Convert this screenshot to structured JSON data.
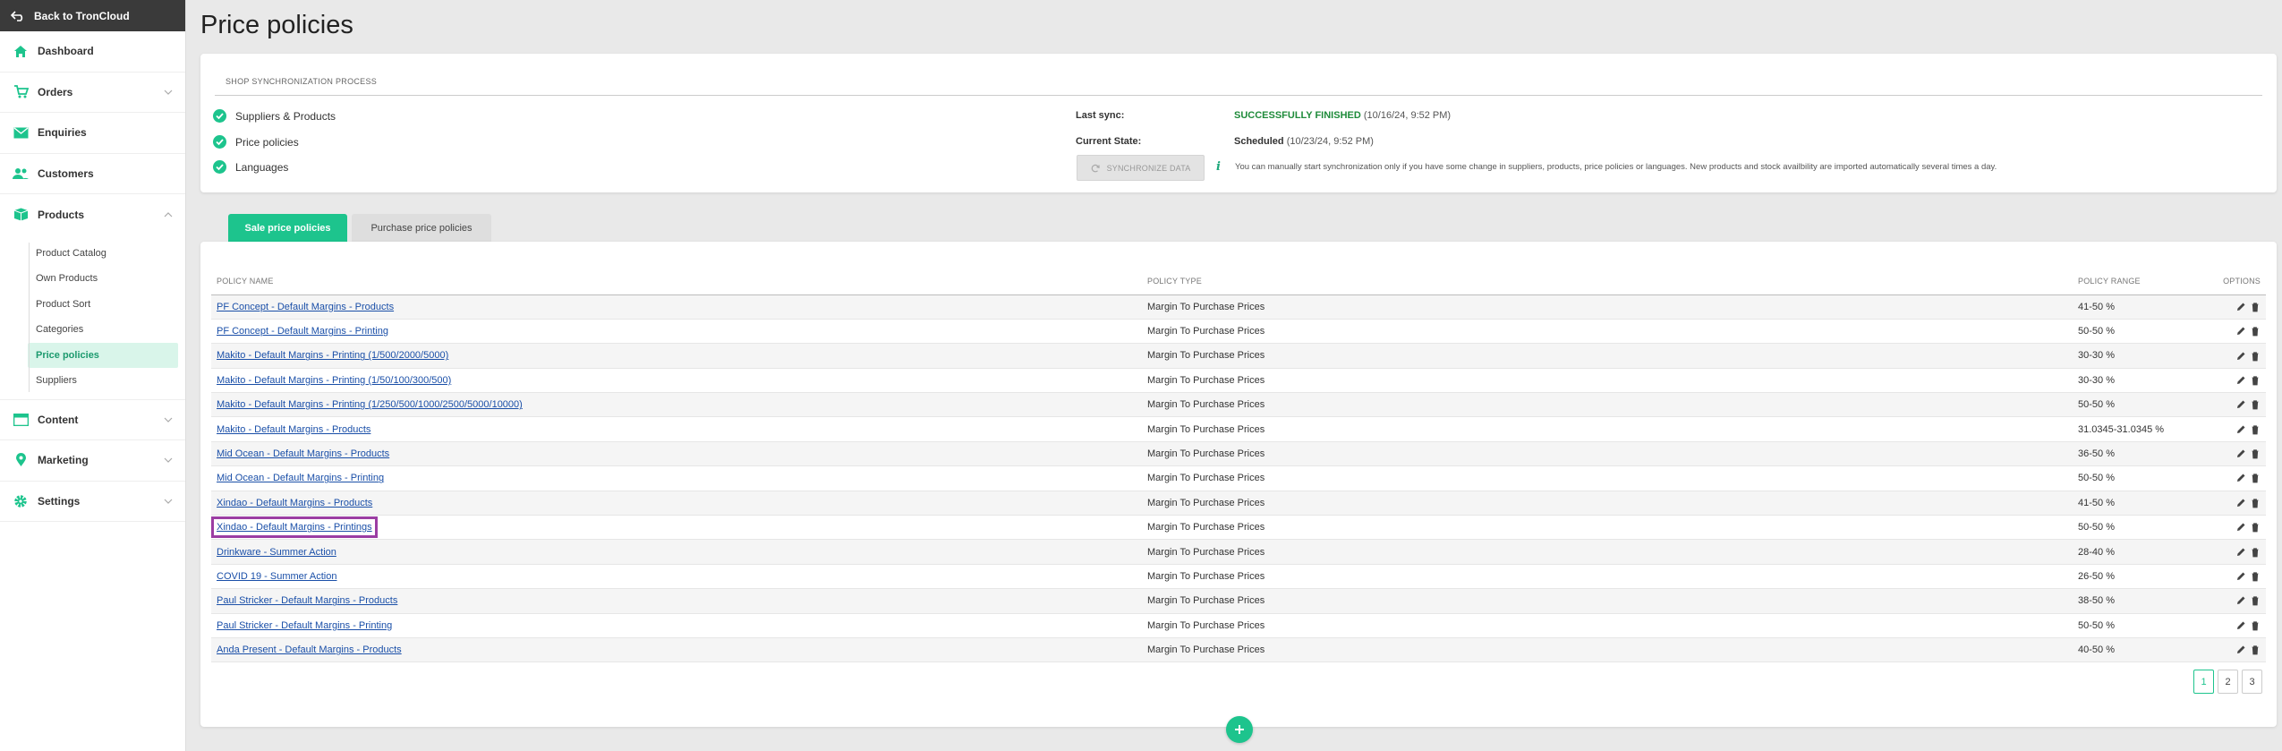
{
  "sidebar": {
    "back_label": "Back to TronCloud",
    "items": [
      {
        "label": "Dashboard"
      },
      {
        "label": "Orders"
      },
      {
        "label": "Enquiries"
      },
      {
        "label": "Customers"
      },
      {
        "label": "Products"
      },
      {
        "label": "Content"
      },
      {
        "label": "Marketing"
      },
      {
        "label": "Settings"
      }
    ],
    "product_subitems": [
      {
        "label": "Product Catalog"
      },
      {
        "label": "Own Products"
      },
      {
        "label": "Product Sort"
      },
      {
        "label": "Categories"
      },
      {
        "label": "Price policies"
      },
      {
        "label": "Suppliers"
      }
    ],
    "active_subitem": "Price policies"
  },
  "page": {
    "title": "Price policies"
  },
  "sync": {
    "heading": "SHOP SYNCHRONIZATION PROCESS",
    "checks": [
      "Suppliers & Products",
      "Price policies",
      "Languages"
    ],
    "last_sync_label": "Last sync:",
    "last_sync_status": "SUCCESSFULLY FINISHED",
    "last_sync_date": "(10/16/24, 9:52 PM)",
    "current_state_label": "Current State:",
    "current_state_value": "Scheduled",
    "current_state_date": "(10/23/24, 9:52 PM)",
    "button_label": "SYNCHRONIZE DATA",
    "note": "You can manually start synchronization only if you have some change in suppliers, products, price policies or languages. New products and stock availbility are imported automatically several times a day."
  },
  "tabs": [
    {
      "label": "Sale price policies",
      "active": true
    },
    {
      "label": "Purchase price policies",
      "active": false
    }
  ],
  "table": {
    "headers": {
      "name": "POLICY NAME",
      "type": "POLICY TYPE",
      "range": "POLICY RANGE",
      "options": "OPTIONS"
    },
    "rows": [
      {
        "name": "PF Concept - Default Margins - Products",
        "type": "Margin To Purchase Prices",
        "range": "41-50 %"
      },
      {
        "name": "PF Concept - Default Margins - Printing",
        "type": "Margin To Purchase Prices",
        "range": "50-50 %"
      },
      {
        "name": "Makito - Default Margins - Printing (1/500/2000/5000)",
        "type": "Margin To Purchase Prices",
        "range": "30-30 %"
      },
      {
        "name": "Makito - Default Margins - Printing (1/50/100/300/500)",
        "type": "Margin To Purchase Prices",
        "range": "30-30 %"
      },
      {
        "name": "Makito - Default Margins - Printing (1/250/500/1000/2500/5000/10000)",
        "type": "Margin To Purchase Prices",
        "range": "50-50 %"
      },
      {
        "name": "Makito - Default Margins - Products",
        "type": "Margin To Purchase Prices",
        "range": "31.0345-31.0345 %"
      },
      {
        "name": "Mid Ocean - Default Margins - Products",
        "type": "Margin To Purchase Prices",
        "range": "36-50 %"
      },
      {
        "name": "Mid Ocean - Default Margins - Printing",
        "type": "Margin To Purchase Prices",
        "range": "50-50 %"
      },
      {
        "name": "Xindao - Default Margins - Products",
        "type": "Margin To Purchase Prices",
        "range": "41-50 %"
      },
      {
        "name": "Xindao - Default Margins - Printings",
        "type": "Margin To Purchase Prices",
        "range": "50-50 %"
      },
      {
        "name": "Drinkware - Summer Action",
        "type": "Margin To Purchase Prices",
        "range": "28-40 %"
      },
      {
        "name": "COVID 19 - Summer Action",
        "type": "Margin To Purchase Prices",
        "range": "26-50 %"
      },
      {
        "name": "Paul Stricker - Default Margins - Products",
        "type": "Margin To Purchase Prices",
        "range": "38-50 %"
      },
      {
        "name": "Paul Stricker - Default Margins - Printing",
        "type": "Margin To Purchase Prices",
        "range": "50-50 %"
      },
      {
        "name": "Anda Present - Default Margins - Products",
        "type": "Margin To Purchase Prices",
        "range": "40-50 %"
      }
    ]
  },
  "pagination": {
    "pages": [
      "1",
      "2",
      "3"
    ],
    "current": "1"
  },
  "colors": {
    "accent": "#1dc48d",
    "link": "#1a4fa8",
    "success": "#1e8b3a",
    "highlight": "#9b3da3"
  },
  "icons": {
    "back": "back-arrow-icon",
    "dashboard": "home-icon",
    "orders": "cart-icon",
    "enquiries": "envelope-icon",
    "customers": "users-icon",
    "products": "box-icon",
    "content": "layout-icon",
    "marketing": "map-pin-icon",
    "settings": "gear-icon",
    "edit": "pencil-icon",
    "delete": "trash-icon",
    "add": "plus-icon"
  }
}
